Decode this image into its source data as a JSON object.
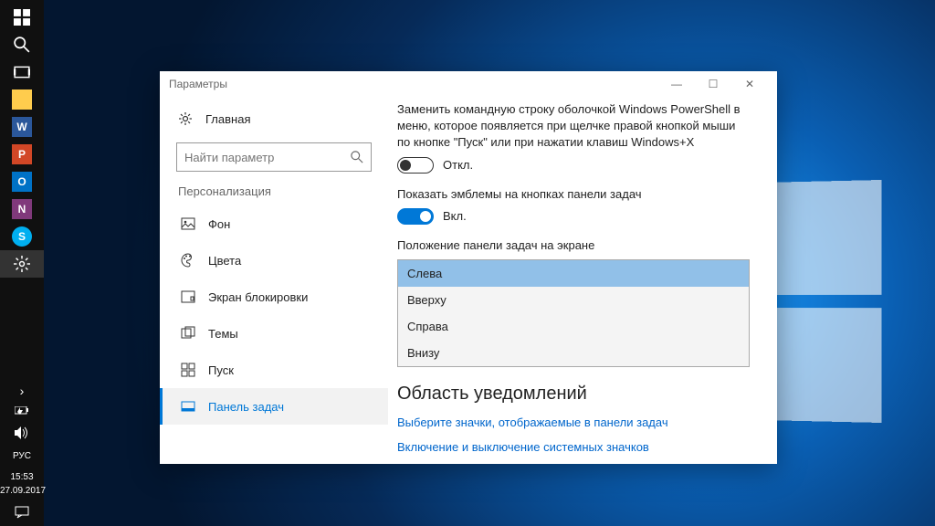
{
  "taskbar": {
    "apps": [
      "start",
      "search",
      "task-view",
      "explorer",
      "word",
      "powerpoint",
      "outlook",
      "onenote",
      "skype",
      "settings"
    ],
    "tiles": {
      "explorer": {
        "bg": "#ffcc4d",
        "txt": ""
      },
      "word": {
        "bg": "#2b579a",
        "txt": "W"
      },
      "powerpoint": {
        "bg": "#d24726",
        "txt": "P"
      },
      "outlook": {
        "bg": "#0072c6",
        "txt": "O"
      },
      "onenote": {
        "bg": "#80397b",
        "txt": "N"
      },
      "skype": {
        "bg": "#00aff0",
        "txt": "S"
      }
    },
    "tray": {
      "lang": "РУС",
      "time": "15:53",
      "date": "27.09.2017"
    }
  },
  "window": {
    "title": "Параметры"
  },
  "sidebar": {
    "home": "Главная",
    "search_placeholder": "Найти параметр",
    "section": "Персонализация",
    "items": [
      {
        "key": "background",
        "label": "Фон"
      },
      {
        "key": "colors",
        "label": "Цвета"
      },
      {
        "key": "lockscreen",
        "label": "Экран блокировки"
      },
      {
        "key": "themes",
        "label": "Темы"
      },
      {
        "key": "start",
        "label": "Пуск"
      },
      {
        "key": "taskbar",
        "label": "Панель задач"
      }
    ],
    "selected": "taskbar"
  },
  "pane": {
    "powershell_desc": "Заменить командную строку оболочкой Windows PowerShell в меню, которое появляется при щелчке правой кнопкой мыши по кнопке \"Пуск\" или при нажатии клавиш Windows+X",
    "off_label": "Откл.",
    "badges_desc": "Показать эмблемы на кнопках панели задач",
    "on_label": "Вкл.",
    "position_label": "Положение панели задач на экране",
    "position_options": [
      "Слева",
      "Вверху",
      "Справа",
      "Внизу"
    ],
    "position_selected": "Слева",
    "notif_heading": "Область уведомлений",
    "link1": "Выберите значки, отображаемые в панели задач",
    "link2": "Включение и выключение системных значков"
  }
}
